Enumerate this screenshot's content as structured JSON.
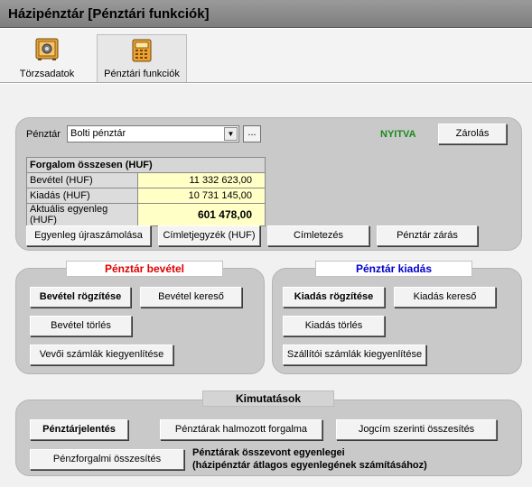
{
  "window": {
    "title": "Házipénztár [Pénztári funkciók]"
  },
  "toolbar": {
    "torzsadatok": {
      "label": "Törzsadatok",
      "icon": "safe-icon"
    },
    "penztari": {
      "label": "Pénztári funkciók",
      "icon": "cash-register-icon"
    }
  },
  "penztar_panel": {
    "penztar_label": "Pénztár",
    "penztar_value": "Bolti pénztár",
    "ellipsis_label": "...",
    "status": "NYITVA",
    "status_color": "#1a8a1a",
    "zarolas_label": "Zárolás",
    "forgalom": {
      "header": "Forgalom összesen (HUF)",
      "rows": [
        {
          "label": "Bevétel (HUF)",
          "value": "11 332 623,00"
        },
        {
          "label": "Kiadás (HUF)",
          "value": "10 731 145,00"
        },
        {
          "label": "Aktuális egyenleg (HUF)",
          "value": "601 478,00"
        }
      ]
    },
    "buttons": {
      "egyenleg": "Egyenleg újraszámolása",
      "cimletjegyzek": "Címletjegyzék (HUF)",
      "cimletezes": "Címletezés",
      "penztar_zaras": "Pénztár zárás"
    }
  },
  "bevetel_panel": {
    "title": "Pénztár bevétel",
    "title_color": "#e00000",
    "rogzites": "Bevétel rögzítése",
    "kereso": "Bevétel kereső",
    "torles": "Bevétel törlés",
    "vevoi": "Vevői számlák kiegyenlítése"
  },
  "kiadas_panel": {
    "title": "Pénztár kiadás",
    "title_color": "#0000cc",
    "rogzites": "Kiadás rögzítése",
    "kereso": "Kiadás kereső",
    "torles": "Kiadás törlés",
    "szallitoi": "Szállítói számlák kiegyenlítése"
  },
  "kimutatasok_panel": {
    "title": "Kimutatások",
    "penztarjelentes": "Pénztárjelentés",
    "halmozott": "Pénztárak halmozott forgalma",
    "jogcim": "Jogcím szerinti összesítés",
    "penzforgalmi": "Pénzforgalmi összesítés",
    "note_line1": "Pénztárak összevont egyenlegei",
    "note_line2": "(házipénztár átlagos egyenlegének számításához)"
  }
}
